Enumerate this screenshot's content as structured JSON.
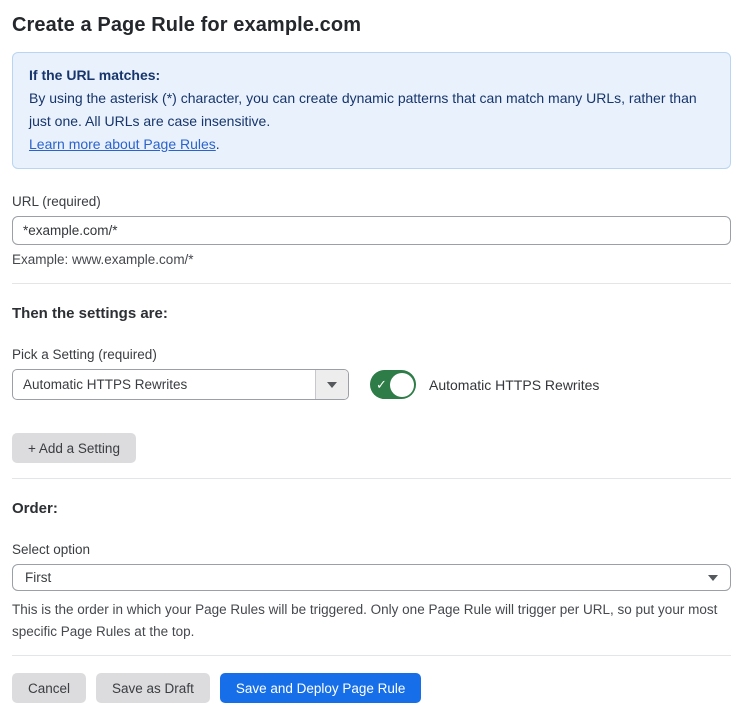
{
  "page": {
    "title": "Create a Page Rule for example.com"
  },
  "info_box": {
    "heading": "If the URL matches:",
    "body": "By using the asterisk (*) character, you can create dynamic patterns that can match many URLs, rather than just one. All URLs are case insensitive.",
    "link_label": "Learn more about Page Rules",
    "link_suffix": "."
  },
  "url_field": {
    "label": "URL (required)",
    "value": "*example.com/*",
    "help": "Example: www.example.com/*"
  },
  "settings": {
    "heading": "Then the settings are:",
    "picker_label": "Pick a Setting (required)",
    "picker_value": "Automatic HTTPS Rewrites",
    "toggle_state": "on",
    "toggle_check": "✓",
    "toggle_label": "Automatic HTTPS Rewrites",
    "add_button_label": "+ Add a Setting"
  },
  "order": {
    "heading": "Order:",
    "select_label": "Select option",
    "select_value": "First",
    "help": "This is the order in which your Page Rules will be triggered. Only one Page Rule will trigger per URL, so put your most specific Page Rules at the top."
  },
  "footer": {
    "cancel_label": "Cancel",
    "save_draft_label": "Save as Draft",
    "save_deploy_label": "Save and Deploy Page Rule"
  },
  "colors": {
    "info_background": "#e9f2fc",
    "info_border": "#b9d5f2",
    "info_text": "#17356c",
    "link_blue": "#2b63cb",
    "primary_blue": "#166fe8",
    "toggle_green": "#2e7c47"
  }
}
